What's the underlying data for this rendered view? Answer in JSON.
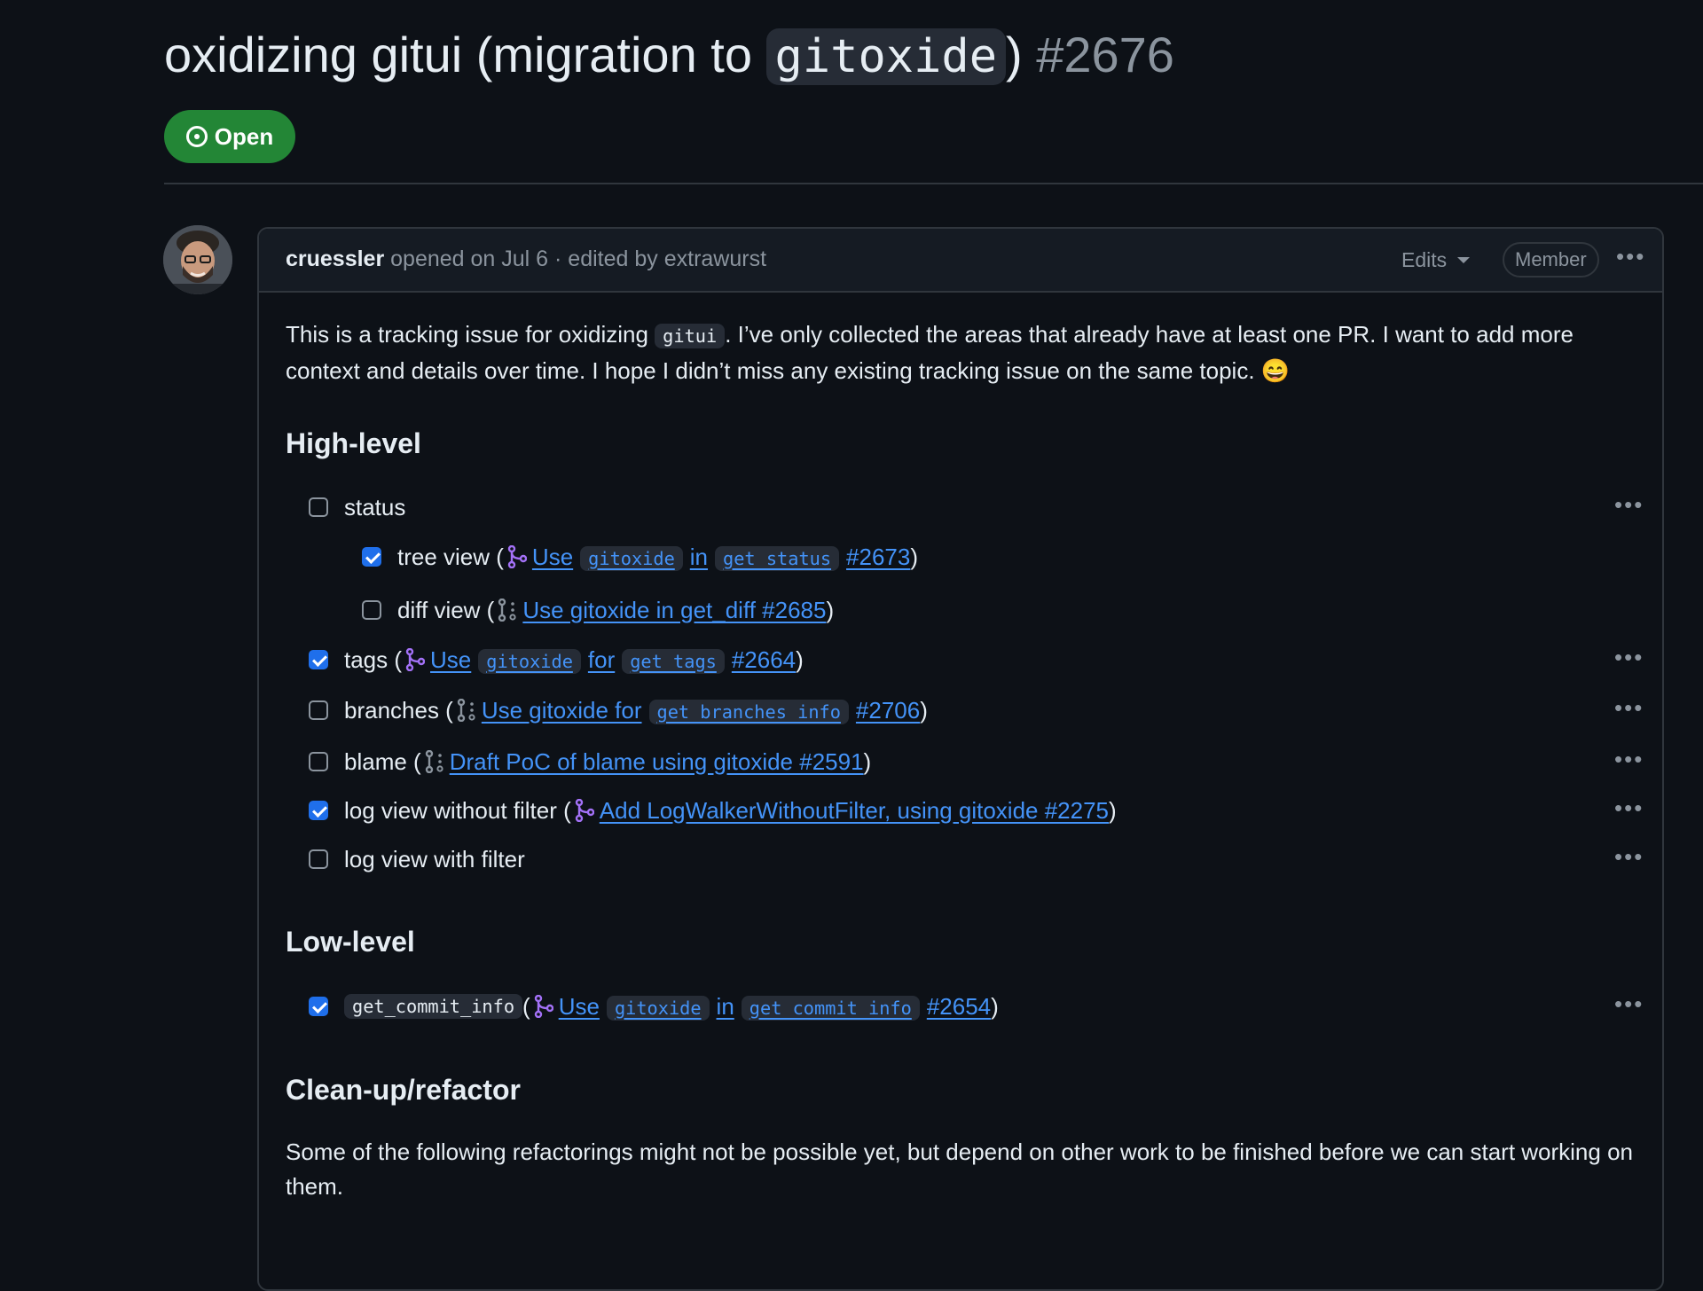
{
  "issue": {
    "title_prefix": "oxidizing gitui (migration to ",
    "title_code": "gitoxide",
    "title_suffix": ")",
    "number": "#2676",
    "state": "Open"
  },
  "comment": {
    "author": "cruessler",
    "meta": "opened on Jul 6 · edited by extrawurst",
    "edits_label": "Edits",
    "role_badge": "Member",
    "intro_part1": "This is a tracking issue for oxidizing ",
    "intro_code": "gitui",
    "intro_part2": ". I’ve only collected the areas that already have at least one PR. I want to add more context and details over time. I hope I didn’t miss any existing tracking issue on the same topic. ",
    "intro_emoji": "😄",
    "sections": {
      "high_level": "High-level",
      "low_level": "Low-level",
      "cleanup": "Clean-up/refactor"
    },
    "cleanup_text": "Some of the following refactorings might not be possible yet, but depend on other work to be finished before we can start working on them."
  },
  "tasks": {
    "status": {
      "label": "status",
      "checked": false
    },
    "tree_view": {
      "label": "tree view (",
      "link": [
        "Use",
        "gitoxide",
        "in",
        "get_status",
        "#2673"
      ],
      "close": ")",
      "checked": true,
      "pr_state": "merged"
    },
    "diff_view": {
      "label": "diff view (",
      "link": "Use gitoxide in get_diff #2685",
      "close": ")",
      "checked": false,
      "pr_state": "draft"
    },
    "tags": {
      "label": "tags (",
      "link": [
        "Use",
        "gitoxide",
        "for",
        "get_tags",
        "#2664"
      ],
      "close": ")",
      "checked": true,
      "pr_state": "merged"
    },
    "branches": {
      "label": "branches (",
      "link": [
        "Use gitoxide for",
        "get_branches_info",
        "#2706"
      ],
      "close": ")",
      "checked": false,
      "pr_state": "draft"
    },
    "blame": {
      "label": "blame (",
      "link": "Draft PoC of blame using gitoxide #2591",
      "close": ")",
      "checked": false,
      "pr_state": "draft"
    },
    "log_without_filter": {
      "label": "log view without filter (",
      "link": "Add LogWalkerWithoutFilter, using gitoxide #2275",
      "close": ")",
      "checked": true,
      "pr_state": "merged"
    },
    "log_with_filter": {
      "label": "log view with filter",
      "checked": false
    },
    "get_commit_info": {
      "label_code": "get_commit_info",
      "open": " (",
      "link": [
        "Use",
        "gitoxide",
        "in",
        "get_commit_info",
        "#2654"
      ],
      "close": ")",
      "checked": true,
      "pr_state": "merged"
    }
  },
  "colors": {
    "background": "#0d1117",
    "link": "#4493f8",
    "open_badge": "#238636",
    "checkbox_checked": "#1f6feb",
    "merged_icon": "#a371f7",
    "draft_icon": "#8b949e"
  }
}
